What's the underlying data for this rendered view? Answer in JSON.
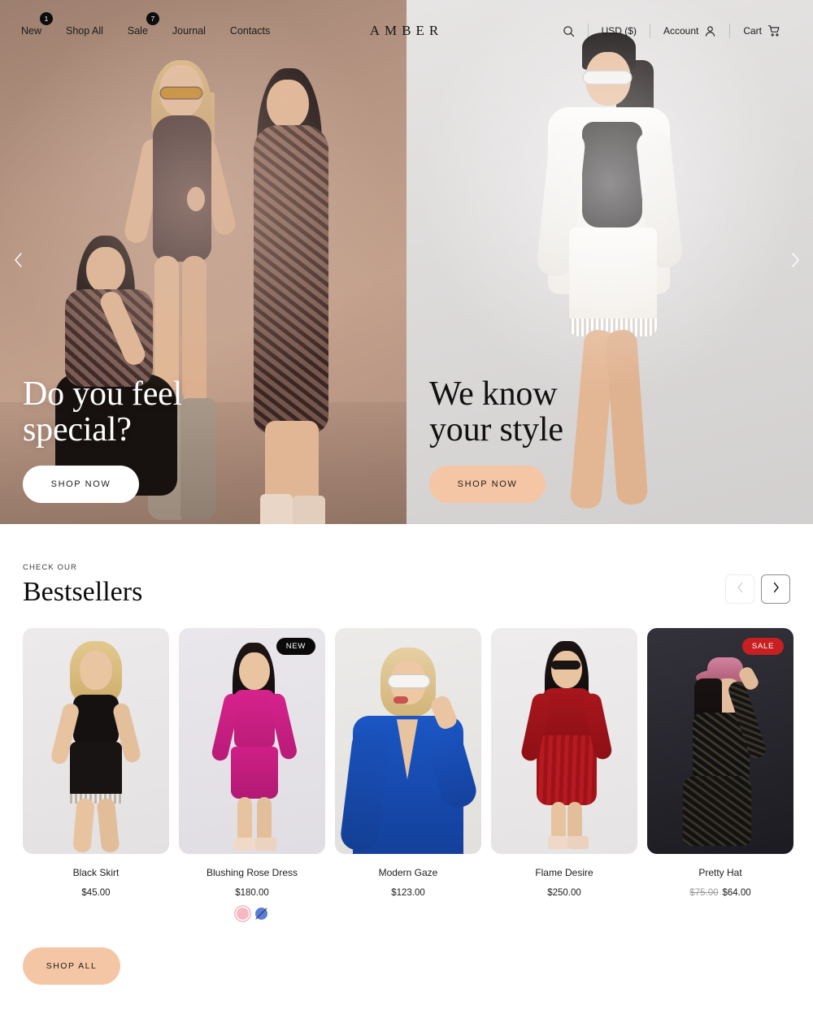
{
  "header": {
    "logo": "AMBER",
    "nav": [
      {
        "label": "New",
        "badge": "1"
      },
      {
        "label": "Shop All",
        "badge": ""
      },
      {
        "label": "Sale",
        "badge": "7"
      },
      {
        "label": "Journal",
        "badge": ""
      },
      {
        "label": "Contacts",
        "badge": ""
      }
    ],
    "search_icon": "search-icon",
    "currency": "USD ($)",
    "account": "Account",
    "account_icon": "user-icon",
    "cart": "Cart",
    "cart_icon": "cart-icon"
  },
  "hero": {
    "prev_icon": "chevron-left-icon",
    "next_icon": "chevron-right-icon",
    "slides": [
      {
        "title": "Do you feel\nspecial?",
        "cta": "SHOP NOW",
        "theme": "light"
      },
      {
        "title": "We know\nyour style",
        "cta": "SHOP NOW",
        "theme": "dark"
      }
    ]
  },
  "bestsellers": {
    "eyebrow": "CHECK OUR",
    "title": "Bestsellers",
    "prev_icon": "chevron-left-icon",
    "next_icon": "chevron-right-icon",
    "shop_all": "SHOP ALL",
    "products": [
      {
        "name": "Black Skirt",
        "price": "$45.00",
        "old_price": "",
        "badge": "",
        "swatches": []
      },
      {
        "name": "Blushing Rose Dress",
        "price": "$180.00",
        "old_price": "",
        "badge": "NEW",
        "swatches": [
          {
            "color": "#f7b8c4",
            "selected": true,
            "out_of_stock": false
          },
          {
            "color": "#5a7fd6",
            "selected": false,
            "out_of_stock": true
          }
        ]
      },
      {
        "name": "Modern Gaze",
        "price": "$123.00",
        "old_price": "",
        "badge": "",
        "swatches": []
      },
      {
        "name": "Flame Desire",
        "price": "$250.00",
        "old_price": "",
        "badge": "",
        "swatches": []
      },
      {
        "name": "Pretty Hat",
        "price": "$64.00",
        "old_price": "$75.00",
        "badge": "SALE",
        "swatches": []
      }
    ]
  },
  "colors": {
    "accent_peach": "#f5c6a5",
    "sale_red": "#c81f22",
    "badge_black": "#0a0a0a"
  }
}
